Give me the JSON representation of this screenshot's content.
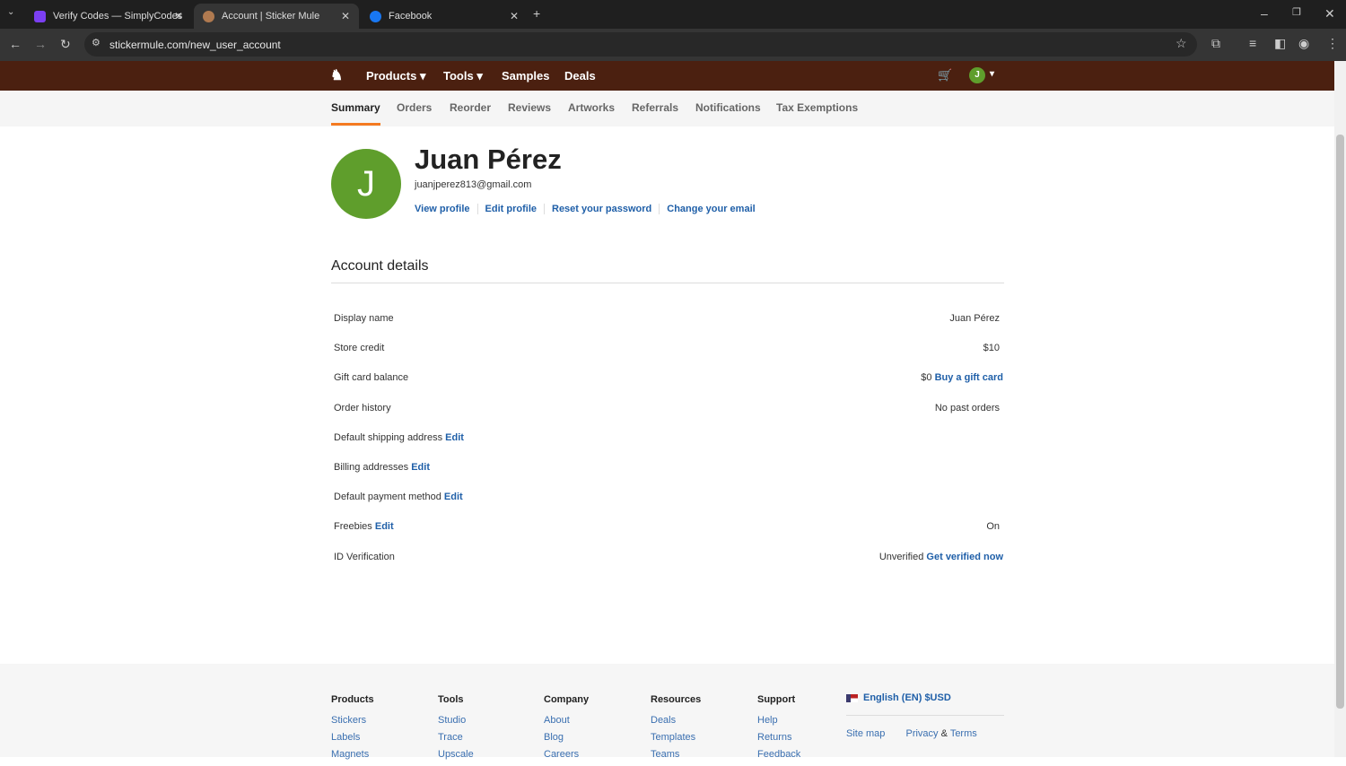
{
  "browser": {
    "tabs": [
      {
        "title": "Verify Codes — SimplyCodes"
      },
      {
        "title": "Account | Sticker Mule"
      },
      {
        "title": "Facebook"
      }
    ],
    "url": "stickermule.com/new_user_account"
  },
  "nav": {
    "items": [
      "Products",
      "Tools",
      "Samples",
      "Deals"
    ],
    "avatar_letter": "J"
  },
  "subnav": [
    "Summary",
    "Orders",
    "Reorder",
    "Reviews",
    "Artworks",
    "Referrals",
    "Notifications",
    "Tax Exemptions"
  ],
  "profile": {
    "initial": "J",
    "name": "Juan Pérez",
    "email": "juanjperez813@gmail.com",
    "links": [
      "View profile",
      "Edit profile",
      "Reset your password",
      "Change your email"
    ]
  },
  "account": {
    "title": "Account details",
    "rows": [
      {
        "label": "Display name",
        "value": "Juan Pérez"
      },
      {
        "label": "Store credit",
        "value": "$10"
      },
      {
        "label": "Gift card balance",
        "value": "$0",
        "value_link": "Buy a gift card"
      },
      {
        "label": "Order history",
        "value": "No past orders"
      },
      {
        "label": "Default shipping address",
        "label_link": "Edit"
      },
      {
        "label": "Billing addresses",
        "label_link": "Edit"
      },
      {
        "label": "Default payment method",
        "label_link": "Edit"
      },
      {
        "label": "Freebies",
        "label_link": "Edit",
        "value": "On"
      },
      {
        "label": "ID Verification",
        "value": "Unverified",
        "value_link": "Get verified now"
      }
    ]
  },
  "footer": {
    "columns": [
      {
        "title": "Products",
        "links": [
          "Stickers",
          "Labels",
          "Magnets"
        ]
      },
      {
        "title": "Tools",
        "links": [
          "Studio",
          "Trace",
          "Upscale"
        ]
      },
      {
        "title": "Company",
        "links": [
          "About",
          "Blog",
          "Careers"
        ]
      },
      {
        "title": "Resources",
        "links": [
          "Deals",
          "Templates",
          "Teams"
        ]
      },
      {
        "title": "Support",
        "links": [
          "Help",
          "Returns",
          "Feedback"
        ]
      }
    ],
    "language": "English (EN) $USD",
    "site_map": "Site map",
    "privacy": "Privacy",
    "amp": "&",
    "terms": "Terms"
  },
  "colors": {
    "nav": "#4b2010",
    "accent": "#f47a20",
    "link": "#1f5fa8",
    "avatar": "#5f9e2c"
  }
}
